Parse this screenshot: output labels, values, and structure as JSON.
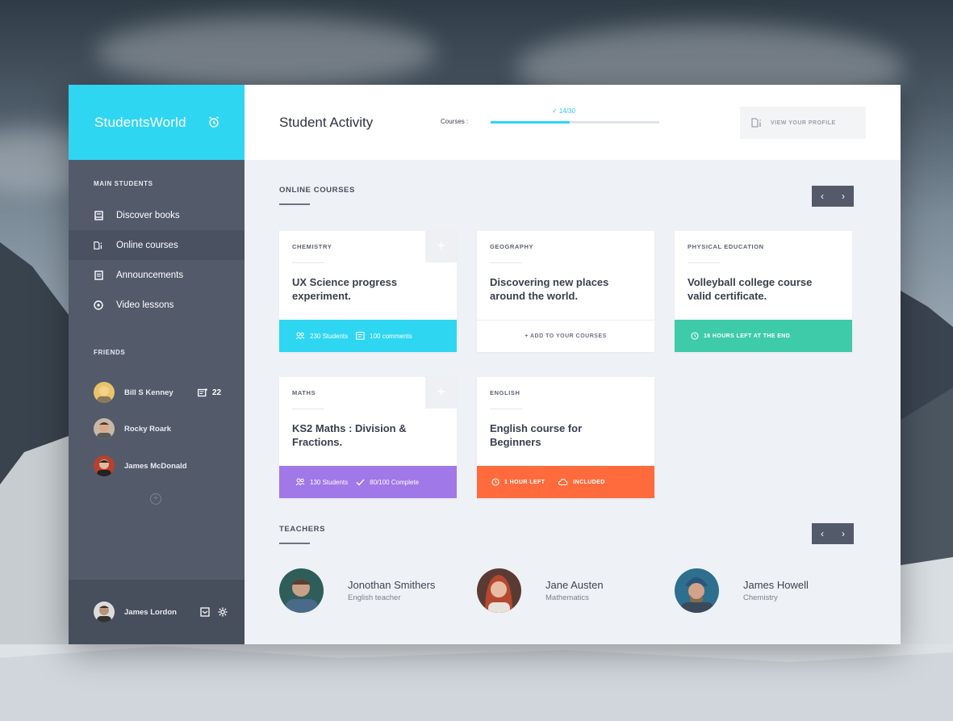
{
  "brand": {
    "name": "StudentsWorld",
    "icon": "alarm-clock-icon"
  },
  "sidebar": {
    "main_title": "MAIN STUDENTS",
    "items": [
      {
        "label": "Discover books",
        "icon": "book-icon",
        "active": false
      },
      {
        "label": "Online courses",
        "icon": "course-icon",
        "active": true
      },
      {
        "label": "Announcements",
        "icon": "announcement-icon",
        "active": false
      },
      {
        "label": "Video lessons",
        "icon": "play-icon",
        "active": false
      }
    ],
    "friends_title": "FRIENDS",
    "friends": [
      {
        "name": "Bill S Kenney",
        "messages": "22"
      },
      {
        "name": "Rocky Roark"
      },
      {
        "name": "James McDonald"
      }
    ],
    "add_friend": "+",
    "user": {
      "name": "James Lordon"
    }
  },
  "header": {
    "title": "Student Activity",
    "courses_label": "Courses :",
    "progress_text": "✓ 14/30",
    "progress_done": 14,
    "progress_total": 30,
    "profile_button": "VIEW YOUR PROFILE"
  },
  "online_courses": {
    "title": "ONLINE COURSES",
    "pager_prev": "‹",
    "pager_next": "›",
    "cards": [
      {
        "category": "CHEMISTRY",
        "title": "UX Science progress experiment.",
        "has_plus": true,
        "foot": {
          "color": "#2fd6f2",
          "items": [
            "230 Students",
            "100 comments"
          ]
        }
      },
      {
        "category": "GEOGRAPHY",
        "title": "Discovering new places around the world.",
        "has_plus": false,
        "foot": {
          "color": "#ffffff",
          "action": "+ ADD TO YOUR COURSES"
        }
      },
      {
        "category": "PHYSICAL EDUCATION",
        "title": "Volleyball college course valid certificate.",
        "has_plus": false,
        "foot": {
          "color": "#3ecba9",
          "items": [
            "16 HOURS LEFT AT THE END"
          ]
        }
      },
      {
        "category": "MATHS",
        "title": "KS2 Maths : Division & Fractions.",
        "has_plus": true,
        "foot": {
          "color": "#a178e8",
          "items": [
            "130 Students",
            "80/100 Complete"
          ]
        }
      },
      {
        "category": "ENGLISH",
        "title": "English course for Beginners",
        "has_plus": false,
        "foot": {
          "color": "#ff6b3d",
          "items": [
            "1 HOUR LEFT",
            "INCLUDED"
          ]
        }
      }
    ]
  },
  "teachers": {
    "title": "TEACHERS",
    "pager_prev": "‹",
    "pager_next": "›",
    "list": [
      {
        "name": "Jonothan Smithers",
        "role": "English teacher"
      },
      {
        "name": "Jane Austen",
        "role": "Mathematics"
      },
      {
        "name": "James Howell",
        "role": "Chemistry"
      }
    ]
  }
}
